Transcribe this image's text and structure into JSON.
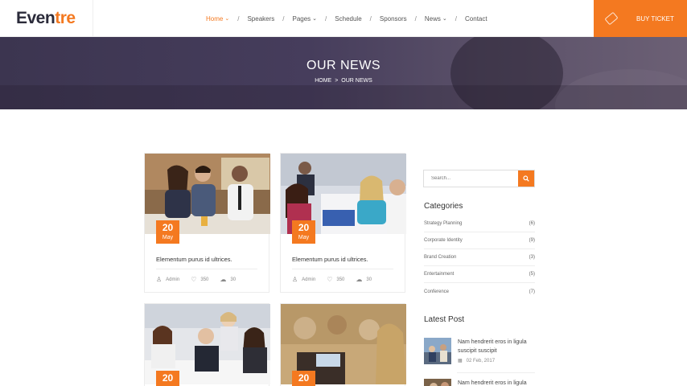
{
  "brand": {
    "logo_main": "Even",
    "logo_accent": "tre",
    "accent_color": "#f47920"
  },
  "nav": {
    "items": [
      {
        "label": "Home",
        "active": true,
        "dropdown": true
      },
      {
        "label": "Speakers",
        "active": false,
        "dropdown": false
      },
      {
        "label": "Pages",
        "active": false,
        "dropdown": true
      },
      {
        "label": "Schedule",
        "active": false,
        "dropdown": false
      },
      {
        "label": "Sponsors",
        "active": false,
        "dropdown": false
      },
      {
        "label": "News",
        "active": false,
        "dropdown": true
      },
      {
        "label": "Contact",
        "active": false,
        "dropdown": false
      }
    ],
    "separator": "/",
    "buy_ticket": "BUY TICKET"
  },
  "banner": {
    "title": "OUR NEWS",
    "breadcrumb": [
      "HOME",
      ">",
      "OUR NEWS"
    ]
  },
  "posts": [
    {
      "day": "20",
      "month": "May",
      "title": "Elementum purus id ultrices.",
      "author": "Admin",
      "likes": "350",
      "comments": "30"
    },
    {
      "day": "20",
      "month": "May",
      "title": "Elementum purus id ultrices.",
      "author": "Admin",
      "likes": "350",
      "comments": "30"
    },
    {
      "day": "20",
      "month": "",
      "title": "",
      "author": "",
      "likes": "",
      "comments": ""
    },
    {
      "day": "20",
      "month": "",
      "title": "",
      "author": "",
      "likes": "",
      "comments": ""
    }
  ],
  "sidebar": {
    "search_placeholder": "Search...",
    "categories_heading": "Categories",
    "categories": [
      {
        "name": "Strategy Planning",
        "count": "(6)"
      },
      {
        "name": "Corporate Identity",
        "count": "(9)"
      },
      {
        "name": "Brand Creation",
        "count": "(3)"
      },
      {
        "name": "Entertainment",
        "count": "(5)"
      },
      {
        "name": "Conference",
        "count": "(7)"
      }
    ],
    "latest_heading": "Latest Post",
    "latest": [
      {
        "line1": "Nam hendrerit eros in ligula",
        "line2": "suscipit suscipit",
        "date": "02 Feb, 2017"
      },
      {
        "line1": "Nam hendrerit eros in ligula",
        "line2": "",
        "date": ""
      }
    ]
  }
}
